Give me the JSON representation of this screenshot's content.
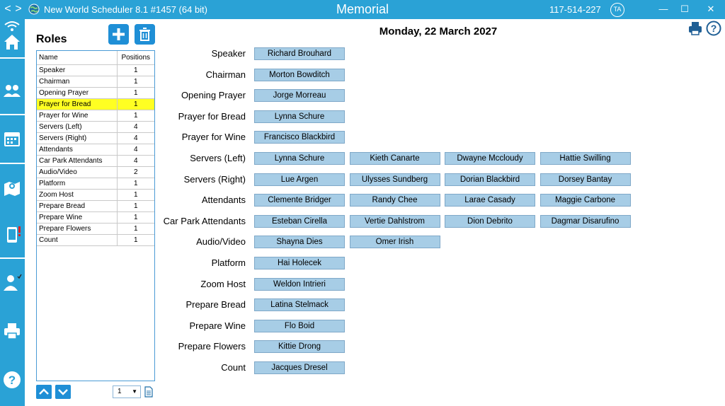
{
  "titlebar": {
    "app_title": "New World Scheduler 8.1 #1457 (64 bit)",
    "screen_title": "Memorial",
    "phone": "117-514-227",
    "avatar_initials": "TA",
    "back_glyph": "<",
    "forward_glyph": ">",
    "minimize_glyph": "—",
    "maximize_glyph": "☐",
    "close_glyph": "✕"
  },
  "sidebar": {
    "icons": [
      "wifi-icon",
      "home-icon",
      "people-icon",
      "calendar-icon",
      "map-icon",
      "phone-alert-icon",
      "person-check-icon",
      "printer-icon",
      "help-icon"
    ]
  },
  "roles_panel": {
    "title": "Roles",
    "columns": [
      "Name",
      "Positions"
    ],
    "selected_index": 3,
    "rows": [
      {
        "name": "Speaker",
        "positions": "1"
      },
      {
        "name": "Chairman",
        "positions": "1"
      },
      {
        "name": "Opening Prayer",
        "positions": "1"
      },
      {
        "name": "Prayer for Bread",
        "positions": "1"
      },
      {
        "name": "Prayer for Wine",
        "positions": "1"
      },
      {
        "name": "Servers (Left)",
        "positions": "4"
      },
      {
        "name": "Servers (Right)",
        "positions": "4"
      },
      {
        "name": "Attendants",
        "positions": "4"
      },
      {
        "name": "Car Park Attendants",
        "positions": "4"
      },
      {
        "name": "Audio/Video",
        "positions": "2"
      },
      {
        "name": "Platform",
        "positions": "1"
      },
      {
        "name": "Zoom Host",
        "positions": "1"
      },
      {
        "name": "Prepare Bread",
        "positions": "1"
      },
      {
        "name": "Prepare Wine",
        "positions": "1"
      },
      {
        "name": "Prepare Flowers",
        "positions": "1"
      },
      {
        "name": "Count",
        "positions": "1"
      }
    ],
    "page_value": "1"
  },
  "main": {
    "date": "Monday, 22 March 2027",
    "assignments": [
      {
        "role": "Speaker",
        "people": [
          "Richard Brouhard"
        ]
      },
      {
        "role": "Chairman",
        "people": [
          "Morton Bowditch"
        ]
      },
      {
        "role": "Opening Prayer",
        "people": [
          "Jorge Morreau"
        ]
      },
      {
        "role": "Prayer for Bread",
        "people": [
          "Lynna Schure"
        ]
      },
      {
        "role": "Prayer for Wine",
        "people": [
          "Francisco Blackbird"
        ]
      },
      {
        "role": "Servers (Left)",
        "people": [
          "Lynna Schure",
          "Kieth Canarte",
          "Dwayne Mccloudy",
          "Hattie Swilling"
        ]
      },
      {
        "role": "Servers (Right)",
        "people": [
          "Lue Argen",
          "Ulysses Sundberg",
          "Dorian Blackbird",
          "Dorsey Bantay"
        ]
      },
      {
        "role": "Attendants",
        "people": [
          "Clemente Bridger",
          "Randy Chee",
          "Larae Casady",
          "Maggie Carbone"
        ]
      },
      {
        "role": "Car Park Attendants",
        "people": [
          "Esteban Cirella",
          "Vertie Dahlstrom",
          "Dion Debrito",
          "Dagmar Disarufino"
        ]
      },
      {
        "role": "Audio/Video",
        "people": [
          "Shayna Dies",
          "Omer Irish"
        ]
      },
      {
        "role": "Platform",
        "people": [
          "Hai Holecek"
        ]
      },
      {
        "role": "Zoom Host",
        "people": [
          "Weldon Intrieri"
        ]
      },
      {
        "role": "Prepare Bread",
        "people": [
          "Latina Stelmack"
        ]
      },
      {
        "role": "Prepare Wine",
        "people": [
          "Flo Boid"
        ]
      },
      {
        "role": "Prepare Flowers",
        "people": [
          "Kittie Drong"
        ]
      },
      {
        "role": "Count",
        "people": [
          "Jacques Dresel"
        ]
      }
    ]
  },
  "colors": {
    "accent": "#2aa2d6",
    "button": "#1f8fd6",
    "assignment_fill": "#a7cde6",
    "selected_row": "#ffff22"
  }
}
